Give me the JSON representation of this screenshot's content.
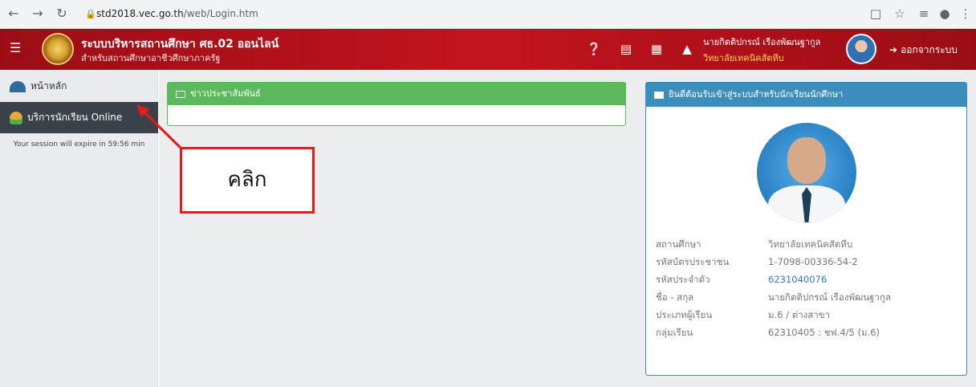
{
  "browser": {
    "back_icon": "arrow-left-icon",
    "forward_icon": "arrow-right-icon",
    "reload_icon": "reload-icon",
    "url_host": "std2018.vec.go.th",
    "url_path": "/web/Login.htm",
    "icons": [
      "translate-icon",
      "star-icon",
      "reading-list-icon",
      "profile-icon",
      "more-icon"
    ]
  },
  "header": {
    "title": "ระบบบริหารสถานศึกษา ศธ.02 ออนไลน์",
    "subtitle": "สำหรับสถานศึกษาอาชีวศึกษาภาครัฐ",
    "user_name": "นายกิตติปกรณ์ เรืองพัฒนฐากูล",
    "user_school": "วิทยาลัยเทคนิคสัตหีบ",
    "logout_label": "ออกจากระบบ",
    "icons": [
      "help-icon",
      "book-icon",
      "calendar-icon",
      "bell-icon"
    ]
  },
  "sidebar": {
    "home_label": "หน้าหลัก",
    "online_label": "บริการนักเรียน Online",
    "session_text": "Your session will expire in 59:56 min"
  },
  "news_panel": {
    "title": "ข่าวประชาสัมพันธ์"
  },
  "welcome_panel": {
    "title": "ยินดีต้อนรับเข้าสู่ระบบสำหรับนักเรียนนักศึกษา",
    "rows": [
      {
        "label": "สถานศึกษา",
        "value": "วิทยาลัยเทคนิคสัตหีบ"
      },
      {
        "label": "รหัสบัตรประชาชน",
        "value": "1-7098-00336-54-2"
      },
      {
        "label": "รหัสประจำตัว",
        "value": "6231040076"
      },
      {
        "label": "ชื่อ - สกุล",
        "value": "นายกิตติปกรณ์ เรืองพัฒนฐากูล"
      },
      {
        "label": "ประเภทผู้เรียน",
        "value": "ม.6 / ต่างสาขา"
      },
      {
        "label": "กลุ่มเรียน",
        "value": "62310405 : ชฟ.4/5 (ม.6)"
      }
    ]
  },
  "annotation": {
    "text": "คลิก",
    "color": "#e51a1a"
  }
}
